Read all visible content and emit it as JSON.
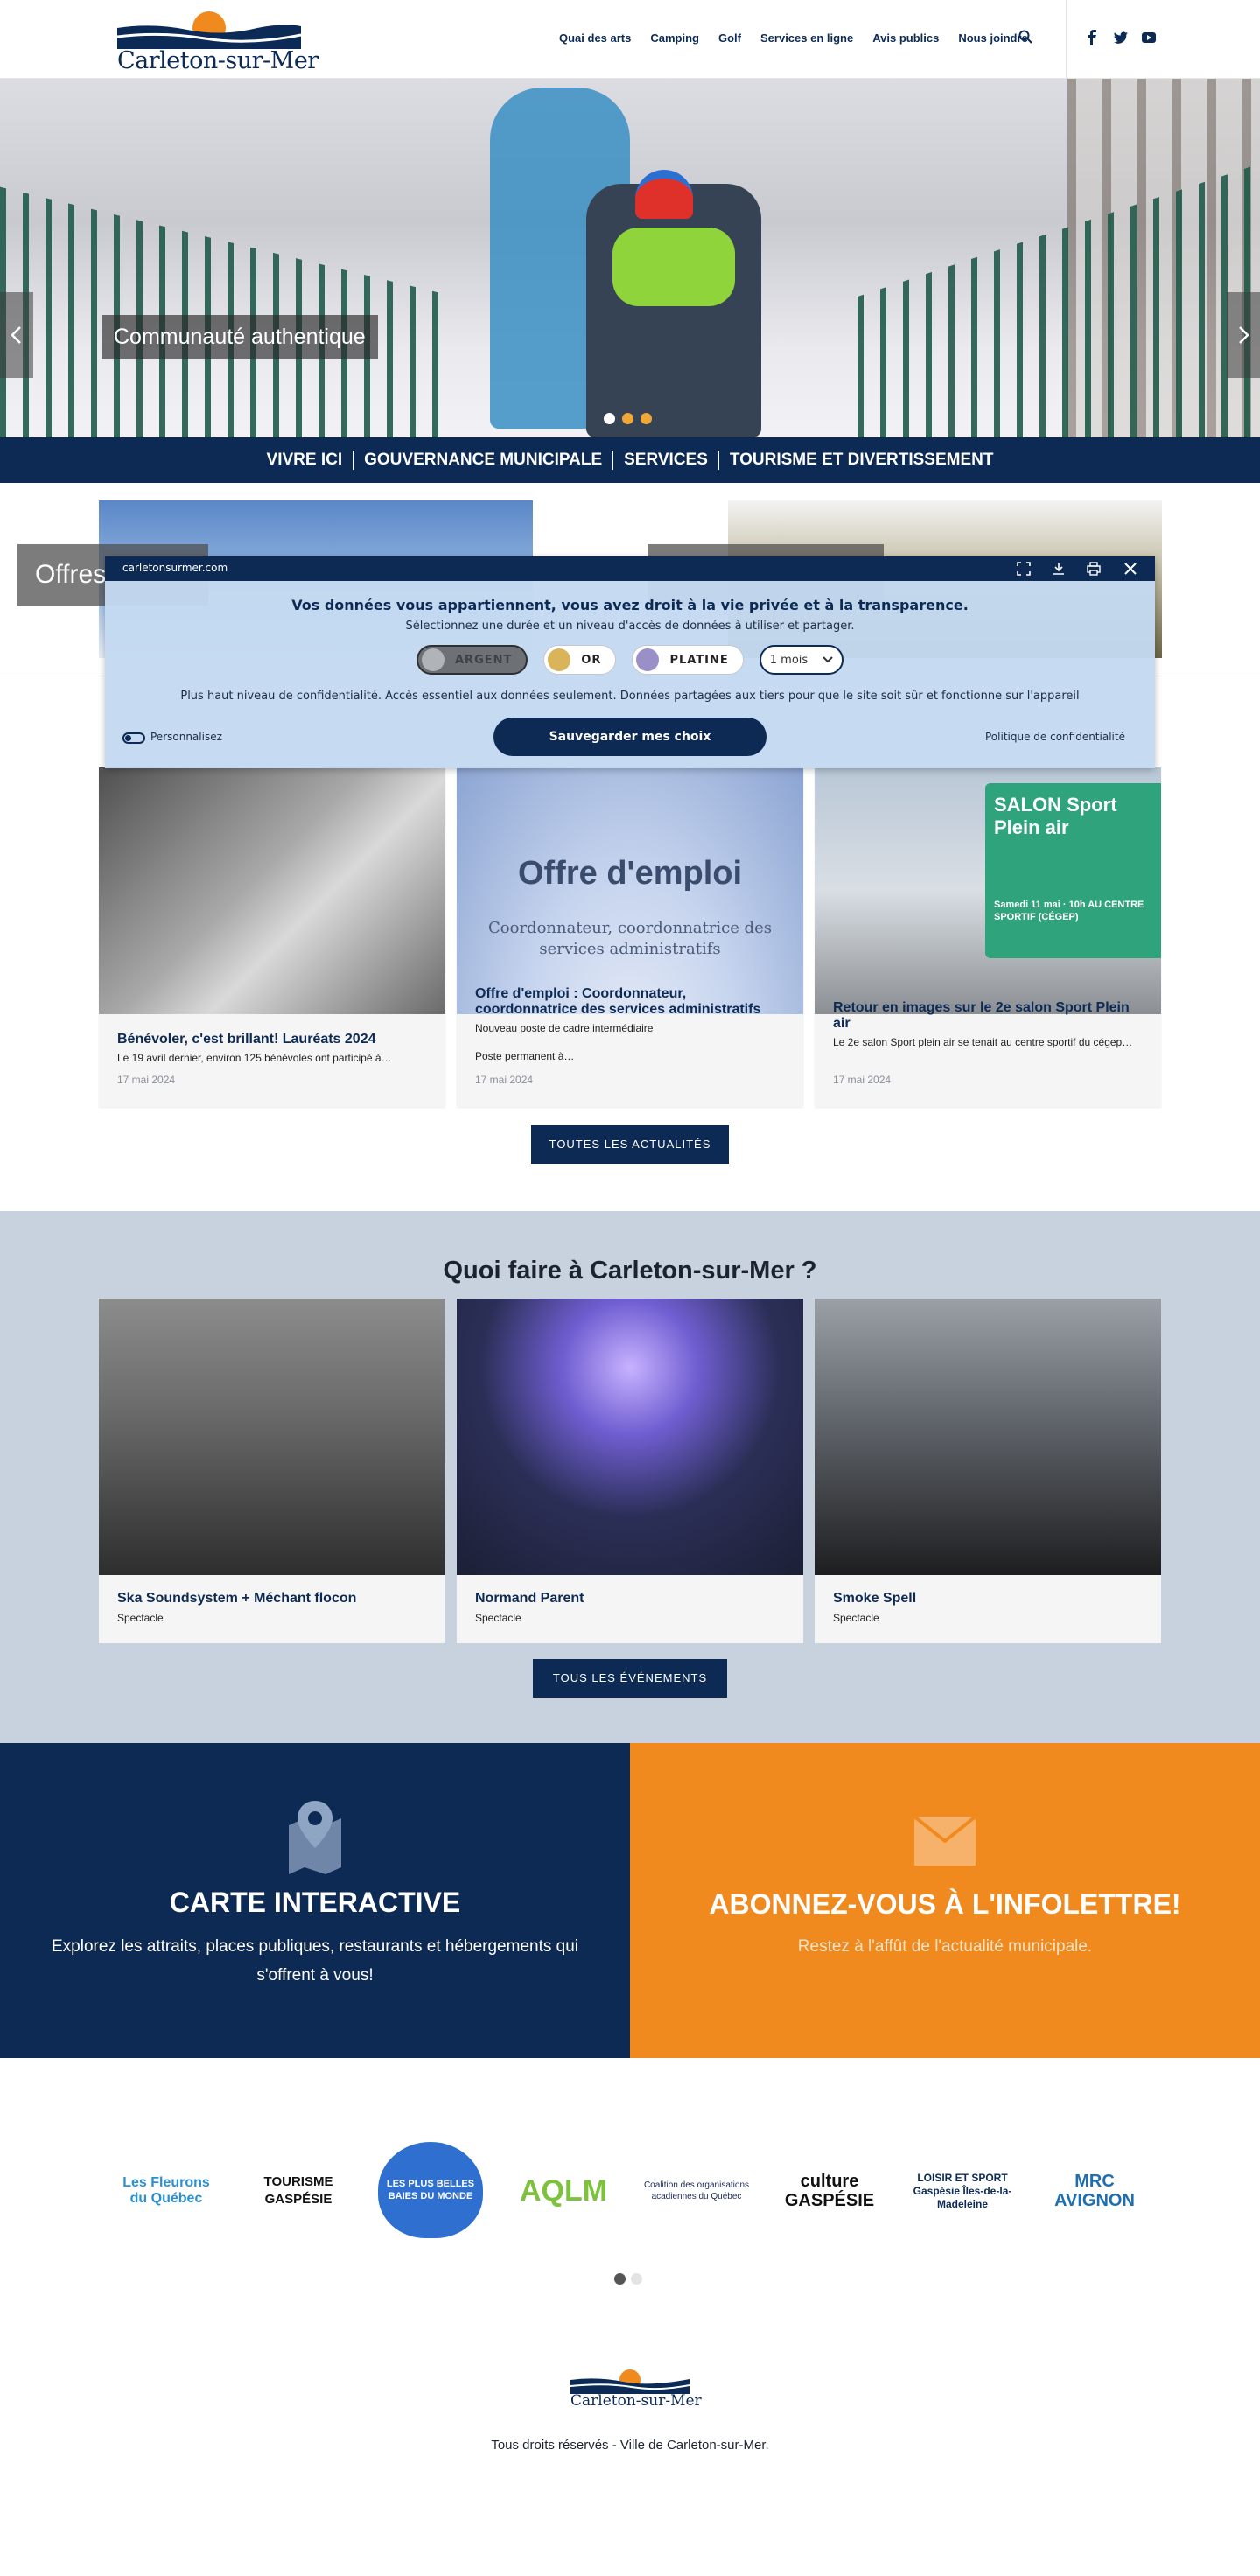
{
  "header": {
    "logo_text": "Carleton-sur-Mer",
    "nav": [
      "Quai des arts",
      "Camping",
      "Golf",
      "Services en ligne",
      "Avis publics",
      "Nous joindre"
    ]
  },
  "hero": {
    "caption": "Communauté authentique",
    "dots": 3,
    "active_dot": 0
  },
  "subnav": [
    "VIVRE ICI",
    "GOUVERNANCE MUNICIPALE",
    "SERVICES",
    "TOURISME ET DIVERTISSEMENT"
  ],
  "offres": {
    "label": "Offres"
  },
  "news": {
    "cards": [
      {
        "title": "Bénévoler, c'est brillant! Lauréats 2024",
        "excerpt": "Le 19 avril dernier, environ 125 bénévoles ont participé à…",
        "date": "17 mai 2024"
      },
      {
        "title": "Offre d'emploi : Coordonnateur, coordonnatrice des services administratifs",
        "excerpt": "Nouveau poste de cadre intermédiaire\n\nPoste permanent à…",
        "date": "17 mai 2024",
        "image_title": "Offre d'emploi",
        "image_sub": "Coordonnateur, coordonnatrice des services administratifs"
      },
      {
        "title": "Retour en images sur le 2e salon Sport Plein air",
        "excerpt": "Le 2e salon Sport plein air se tenait au centre sportif du cégep…",
        "date": "17 mai 2024",
        "image_sign": "SALON Sport Plein air",
        "image_sign_sub": "Samedi 11 mai · 10h AU CENTRE SPORTIF (CÉGEP)"
      }
    ],
    "all_button": "TOUTES LES ACTUALITÉS"
  },
  "events": {
    "title": "Quoi faire à Carleton-sur-Mer ?",
    "cards": [
      {
        "title": "Ska Soundsystem + Méchant flocon",
        "category": "Spectacle"
      },
      {
        "title": "Normand Parent",
        "category": "Spectacle"
      },
      {
        "title": "Smoke Spell",
        "category": "Spectacle"
      }
    ],
    "all_button": "TOUS LES ÉVÉNEMENTS"
  },
  "cta": {
    "map": {
      "title": "CARTE INTERACTIVE",
      "text": "Explorez les attraits, places publiques, restaurants et hébergements qui s'offrent à vous!"
    },
    "newsletter": {
      "title": "ABONNEZ-VOUS À L'INFOLETTRE!",
      "text": "Restez à l'affût de l'actualité municipale."
    }
  },
  "partners": {
    "logos": [
      {
        "text": "Les Fleurons du Québec",
        "color": "#2b8fd0"
      },
      {
        "text": "TOURISME GASPÉSIE",
        "color": "#111111"
      },
      {
        "text": "LES PLUS BELLES BAIES DU MONDE",
        "color": "#2456b8"
      },
      {
        "text": "AQLM",
        "color": "#7cc23c"
      },
      {
        "text": "Coalition des organisations acadiennes du Québec",
        "color": "#1b2a55"
      },
      {
        "text": "culture GASPÉSIE",
        "color": "#111111"
      },
      {
        "text": "LOISIR ET SPORT Gaspésie Îles-de-la-Madeleine",
        "color": "#0d2a54"
      },
      {
        "text": "MRC AVIGNON",
        "color": "#1f6fb0"
      }
    ],
    "dots": 2,
    "active_dot": 0
  },
  "footer": {
    "logo_text": "Carleton-sur-Mer",
    "copyright": "Tous droits réservés - Ville de Carleton-sur-Mer."
  },
  "consent": {
    "domain": "carletonsurmer.com",
    "heading": "Vos données vous appartiennent, vous avez droit à la vie privée et à la transparence.",
    "subheading": "Sélectionnez une durée et un niveau d'accès de données à utiliser et partager.",
    "levels": [
      {
        "label": "ARGENT",
        "color": "#b0b3b8",
        "selected": true
      },
      {
        "label": "OR",
        "color": "#d9b45a",
        "selected": false
      },
      {
        "label": "PLATINE",
        "color": "#9a8fc6",
        "selected": false
      }
    ],
    "duration": "1 mois",
    "description": "Plus haut niveau de confidentialité. Accès essentiel aux données seulement. Données partagées aux tiers pour que le site soit sûr et fonctionne sur l'appareil",
    "save_button": "Sauvegarder mes choix",
    "customize": "Personnalisez",
    "policy": "Politique de confidentialité"
  },
  "colors": {
    "navy": "#0d2a54",
    "orange": "#f08a1e",
    "events_bg": "#c8d2df"
  }
}
